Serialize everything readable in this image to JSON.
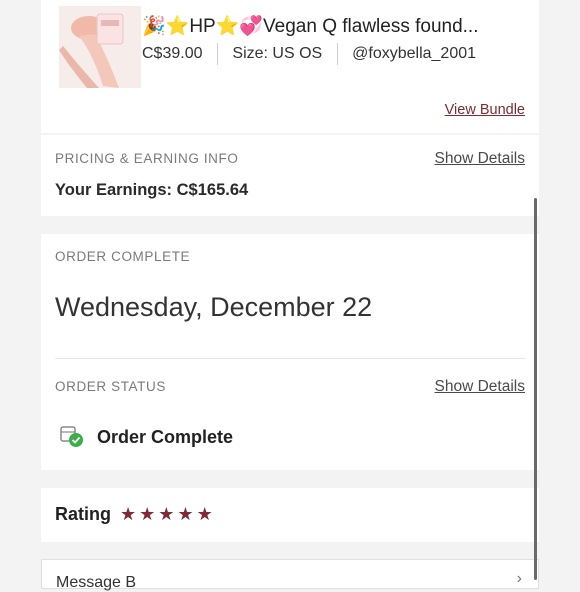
{
  "product": {
    "title": "🎉⭐HP⭐💞Vegan Q flawless found...",
    "price": "C$39.00",
    "size": "Size: US OS",
    "seller": "@foxybella_2001",
    "view_bundle_label": "View Bundle"
  },
  "pricing": {
    "section_label": "PRICING & EARNING INFO",
    "show_details_label": "Show Details",
    "earnings_text": "Your Earnings: C$165.64"
  },
  "order_complete": {
    "section_label": "ORDER COMPLETE",
    "date": "Wednesday, December 22"
  },
  "order_status": {
    "section_label": "ORDER STATUS",
    "show_details_label": "Show Details",
    "status_text": "Order Complete"
  },
  "rating": {
    "label": "Rating",
    "stars": 5,
    "star_color": "#7d2b35"
  },
  "message": {
    "label": "Message B"
  },
  "colors": {
    "link": "#7d2b35",
    "check": "#3cae4a"
  }
}
